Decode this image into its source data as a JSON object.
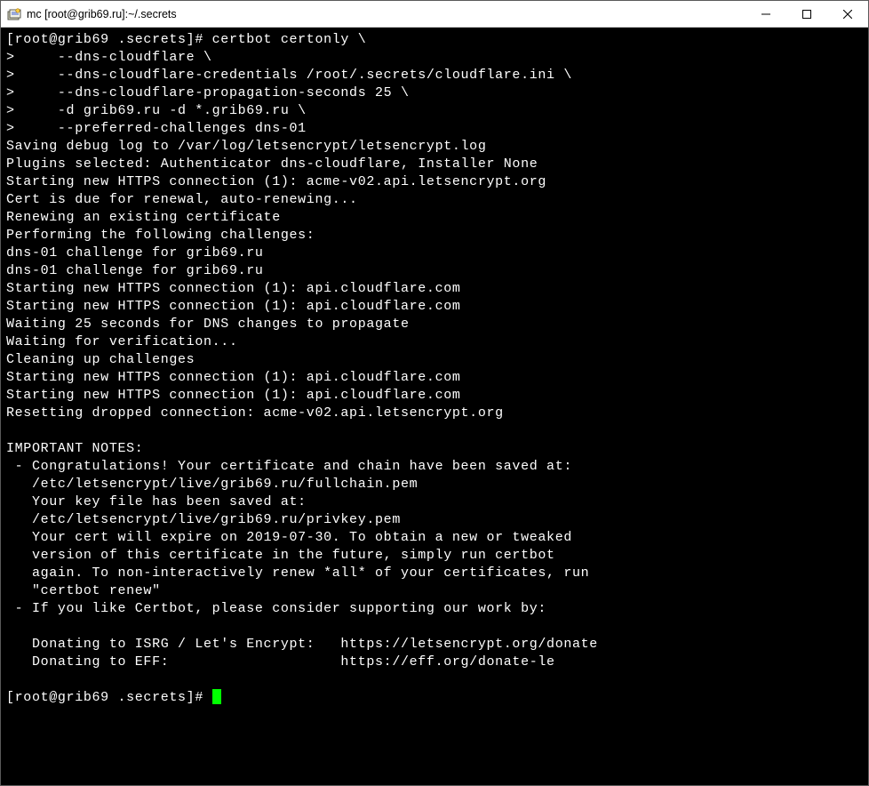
{
  "window": {
    "title": "mc [root@grib69.ru]:~/.secrets"
  },
  "terminal": {
    "lines": [
      "[root@grib69 .secrets]# certbot certonly \\",
      ">     --dns-cloudflare \\",
      ">     --dns-cloudflare-credentials /root/.secrets/cloudflare.ini \\",
      ">     --dns-cloudflare-propagation-seconds 25 \\",
      ">     -d grib69.ru -d *.grib69.ru \\",
      ">     --preferred-challenges dns-01",
      "Saving debug log to /var/log/letsencrypt/letsencrypt.log",
      "Plugins selected: Authenticator dns-cloudflare, Installer None",
      "Starting new HTTPS connection (1): acme-v02.api.letsencrypt.org",
      "Cert is due for renewal, auto-renewing...",
      "Renewing an existing certificate",
      "Performing the following challenges:",
      "dns-01 challenge for grib69.ru",
      "dns-01 challenge for grib69.ru",
      "Starting new HTTPS connection (1): api.cloudflare.com",
      "Starting new HTTPS connection (1): api.cloudflare.com",
      "Waiting 25 seconds for DNS changes to propagate",
      "Waiting for verification...",
      "Cleaning up challenges",
      "Starting new HTTPS connection (1): api.cloudflare.com",
      "Starting new HTTPS connection (1): api.cloudflare.com",
      "Resetting dropped connection: acme-v02.api.letsencrypt.org",
      "",
      "IMPORTANT NOTES:",
      " - Congratulations! Your certificate and chain have been saved at:",
      "   /etc/letsencrypt/live/grib69.ru/fullchain.pem",
      "   Your key file has been saved at:",
      "   /etc/letsencrypt/live/grib69.ru/privkey.pem",
      "   Your cert will expire on 2019-07-30. To obtain a new or tweaked",
      "   version of this certificate in the future, simply run certbot",
      "   again. To non-interactively renew *all* of your certificates, run",
      "   \"certbot renew\"",
      " - If you like Certbot, please consider supporting our work by:",
      "",
      "   Donating to ISRG / Let's Encrypt:   https://letsencrypt.org/donate",
      "   Donating to EFF:                    https://eff.org/donate-le",
      ""
    ],
    "prompt_final": "[root@grib69 .secrets]# "
  }
}
